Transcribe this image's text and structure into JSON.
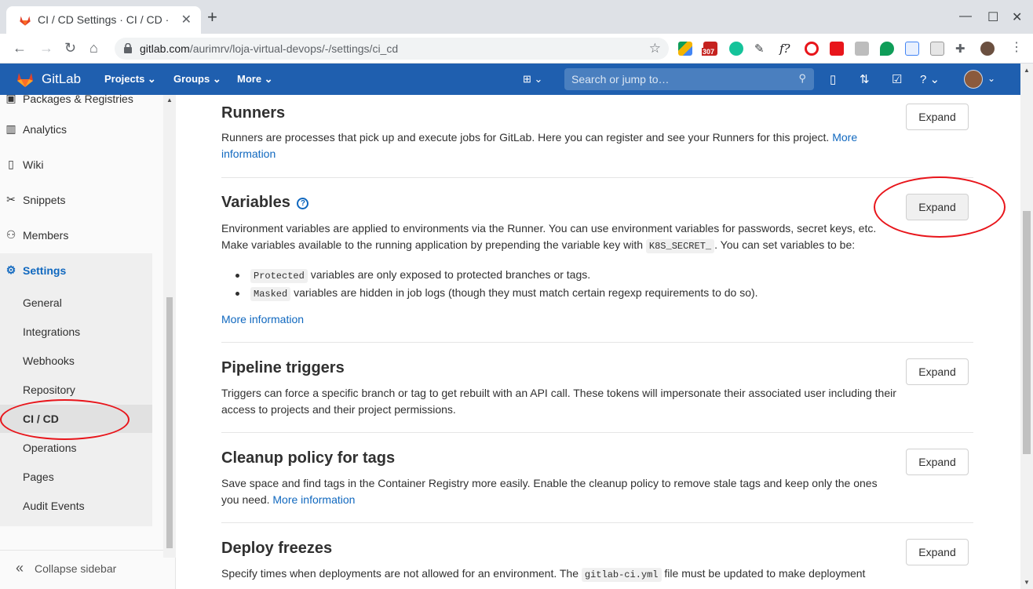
{
  "browser": {
    "tab_title": "CI / CD Settings · CI / CD · ",
    "url_host": "gitlab.com",
    "url_path": "/aurimrv/loja-virtual-devops/-/settings/ci_cd",
    "gmail_badge": "307"
  },
  "navbar": {
    "brand": "GitLab",
    "menu": [
      "Projects",
      "Groups",
      "More"
    ],
    "search_placeholder": "Search or jump to…"
  },
  "sidebar": {
    "top_partial": "Packages & Registries",
    "items": [
      {
        "label": "Analytics",
        "icon": "chart-icon"
      },
      {
        "label": "Wiki",
        "icon": "book-icon"
      },
      {
        "label": "Snippets",
        "icon": "scissors-icon"
      },
      {
        "label": "Members",
        "icon": "users-icon"
      },
      {
        "label": "Settings",
        "icon": "gear-icon"
      }
    ],
    "sub_items": [
      "General",
      "Integrations",
      "Webhooks",
      "Repository",
      "CI / CD",
      "Operations",
      "Pages",
      "Audit Events"
    ],
    "active_sub": "CI / CD",
    "collapse_label": "Collapse sidebar"
  },
  "sections": {
    "runners": {
      "title": "Runners",
      "desc": "Runners are processes that pick up and execute jobs for GitLab. Here you can register and see your Runners for this project.",
      "link": "More information",
      "button": "Expand"
    },
    "variables": {
      "title": "Variables",
      "desc1": "Environment variables are applied to environments via the Runner. You can use environment variables for passwords, secret keys, etc.",
      "desc2a": "Make variables available to the running application by prepending the variable key with",
      "desc2_code": "K8S_SECRET_",
      "desc2b": ". You can set variables to be:",
      "bullet1_code": "Protected",
      "bullet1_text": "variables are only exposed to protected branches or tags.",
      "bullet2_code": "Masked",
      "bullet2_text": "variables are hidden in job logs (though they must match certain regexp requirements to do so).",
      "link": "More information",
      "button": "Expand"
    },
    "triggers": {
      "title": "Pipeline triggers",
      "desc": "Triggers can force a specific branch or tag to get rebuilt with an API call. These tokens will impersonate their associated user including their access to projects and their project permissions.",
      "button": "Expand"
    },
    "cleanup": {
      "title": "Cleanup policy for tags",
      "desc": "Save space and find tags in the Container Registry more easily. Enable the cleanup policy to remove stale tags and keep only the ones you need.",
      "link": "More information",
      "button": "Expand"
    },
    "freezes": {
      "title": "Deploy freezes",
      "desc_a": "Specify times when deployments are not allowed for an environment. The",
      "desc_code": "gitlab-ci.yml",
      "desc_b": "file must be updated to make deployment",
      "button": "Expand"
    }
  },
  "colors": {
    "gitlab_blue": "#1f5faf",
    "link": "#1068bf",
    "annotation_red": "#e8151b"
  }
}
